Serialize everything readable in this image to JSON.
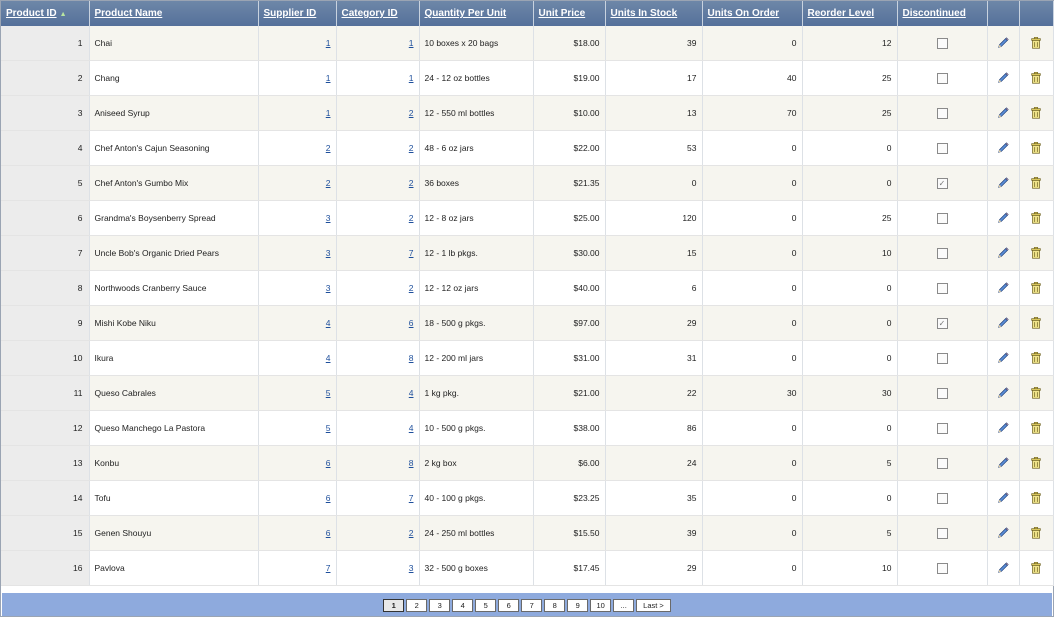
{
  "columns": [
    {
      "key": "product_id",
      "label": "Product ID",
      "sorted": true
    },
    {
      "key": "product_name",
      "label": "Product Name"
    },
    {
      "key": "supplier_id",
      "label": "Supplier ID"
    },
    {
      "key": "category_id",
      "label": "Category ID"
    },
    {
      "key": "quantity_per_unit",
      "label": "Quantity Per Unit"
    },
    {
      "key": "unit_price",
      "label": "Unit Price"
    },
    {
      "key": "units_in_stock",
      "label": "Units In Stock"
    },
    {
      "key": "units_on_order",
      "label": "Units On Order"
    },
    {
      "key": "reorder_level",
      "label": "Reorder Level"
    },
    {
      "key": "discontinued",
      "label": "Discontinued"
    }
  ],
  "icons": {
    "sort": "sort-ascending-icon",
    "edit": "pencil-edit-icon",
    "delete": "trash-delete-icon",
    "check": "✓"
  },
  "colors": {
    "header": "#5f7aa0",
    "pager": "#8eaadd",
    "link": "#1e4f9c",
    "alt_row": "#f6f5ef"
  },
  "rows": [
    {
      "id": "1",
      "name": "Chai",
      "supplier": "1",
      "category": "1",
      "qty": "10 boxes x 20 bags",
      "price": "$18.00",
      "stock": "39",
      "order": "0",
      "reorder": "12",
      "discontinued": false
    },
    {
      "id": "2",
      "name": "Chang",
      "supplier": "1",
      "category": "1",
      "qty": "24 - 12 oz bottles",
      "price": "$19.00",
      "stock": "17",
      "order": "40",
      "reorder": "25",
      "discontinued": false
    },
    {
      "id": "3",
      "name": "Aniseed Syrup",
      "supplier": "1",
      "category": "2",
      "qty": "12 - 550 ml bottles",
      "price": "$10.00",
      "stock": "13",
      "order": "70",
      "reorder": "25",
      "discontinued": false
    },
    {
      "id": "4",
      "name": "Chef Anton's Cajun Seasoning",
      "supplier": "2",
      "category": "2",
      "qty": "48 - 6 oz jars",
      "price": "$22.00",
      "stock": "53",
      "order": "0",
      "reorder": "0",
      "discontinued": false
    },
    {
      "id": "5",
      "name": "Chef Anton's Gumbo Mix",
      "supplier": "2",
      "category": "2",
      "qty": "36 boxes",
      "price": "$21.35",
      "stock": "0",
      "order": "0",
      "reorder": "0",
      "discontinued": true
    },
    {
      "id": "6",
      "name": "Grandma's Boysenberry Spread",
      "supplier": "3",
      "category": "2",
      "qty": "12 - 8 oz jars",
      "price": "$25.00",
      "stock": "120",
      "order": "0",
      "reorder": "25",
      "discontinued": false
    },
    {
      "id": "7",
      "name": "Uncle Bob's Organic Dried Pears",
      "supplier": "3",
      "category": "7",
      "qty": "12 - 1 lb pkgs.",
      "price": "$30.00",
      "stock": "15",
      "order": "0",
      "reorder": "10",
      "discontinued": false
    },
    {
      "id": "8",
      "name": "Northwoods Cranberry Sauce",
      "supplier": "3",
      "category": "2",
      "qty": "12 - 12 oz jars",
      "price": "$40.00",
      "stock": "6",
      "order": "0",
      "reorder": "0",
      "discontinued": false
    },
    {
      "id": "9",
      "name": "Mishi Kobe Niku",
      "supplier": "4",
      "category": "6",
      "qty": "18 - 500 g pkgs.",
      "price": "$97.00",
      "stock": "29",
      "order": "0",
      "reorder": "0",
      "discontinued": true
    },
    {
      "id": "10",
      "name": "Ikura",
      "supplier": "4",
      "category": "8",
      "qty": "12 - 200 ml jars",
      "price": "$31.00",
      "stock": "31",
      "order": "0",
      "reorder": "0",
      "discontinued": false
    },
    {
      "id": "11",
      "name": "Queso Cabrales",
      "supplier": "5",
      "category": "4",
      "qty": "1 kg pkg.",
      "price": "$21.00",
      "stock": "22",
      "order": "30",
      "reorder": "30",
      "discontinued": false
    },
    {
      "id": "12",
      "name": "Queso Manchego La Pastora",
      "supplier": "5",
      "category": "4",
      "qty": "10 - 500 g pkgs.",
      "price": "$38.00",
      "stock": "86",
      "order": "0",
      "reorder": "0",
      "discontinued": false
    },
    {
      "id": "13",
      "name": "Konbu",
      "supplier": "6",
      "category": "8",
      "qty": "2 kg box",
      "price": "$6.00",
      "stock": "24",
      "order": "0",
      "reorder": "5",
      "discontinued": false
    },
    {
      "id": "14",
      "name": "Tofu",
      "supplier": "6",
      "category": "7",
      "qty": "40 - 100 g pkgs.",
      "price": "$23.25",
      "stock": "35",
      "order": "0",
      "reorder": "0",
      "discontinued": false
    },
    {
      "id": "15",
      "name": "Genen Shouyu",
      "supplier": "6",
      "category": "2",
      "qty": "24 - 250 ml bottles",
      "price": "$15.50",
      "stock": "39",
      "order": "0",
      "reorder": "5",
      "discontinued": false
    },
    {
      "id": "16",
      "name": "Pavlova",
      "supplier": "7",
      "category": "3",
      "qty": "32 - 500 g boxes",
      "price": "$17.45",
      "stock": "29",
      "order": "0",
      "reorder": "10",
      "discontinued": false
    }
  ],
  "pager": {
    "current": "1",
    "pages": [
      "1",
      "2",
      "3",
      "4",
      "5",
      "6",
      "7",
      "8",
      "9",
      "10",
      "..."
    ],
    "last_label": "Last >"
  }
}
